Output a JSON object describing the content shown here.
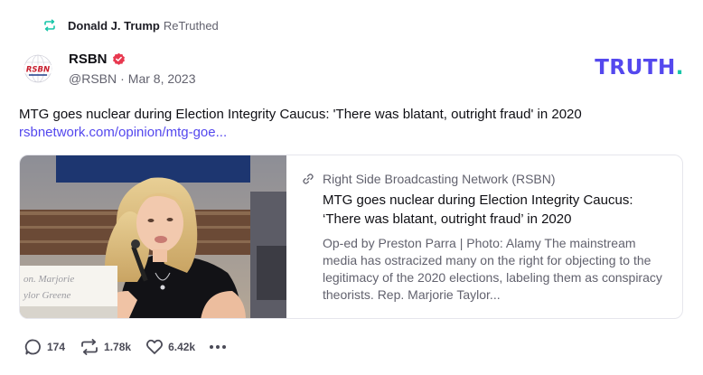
{
  "retruth": {
    "user": "Donald J. Trump",
    "label": "ReTruthed"
  },
  "author": {
    "avatar_text": "RSBN",
    "name": "RSBN",
    "handle": "@RSBN",
    "separator": "·",
    "date": "Mar 8, 2023"
  },
  "brand": {
    "word": "TRUTH",
    "dot": "."
  },
  "post": {
    "text": "MTG goes nuclear during Election Integrity Caucus: 'There was blatant, outright fraud' in 2020",
    "link": "rsbnetwork.com/opinion/mtg-goe..."
  },
  "card": {
    "image_nameplate": "on. Marjorie\nylor Greene",
    "source": "Right Side Broadcasting Network (RSBN)",
    "title": "MTG goes nuclear during Election Integrity Caucus: ‘There was blatant, outright fraud’ in 2020",
    "description": "Op-ed by Preston Parra | Photo: Alamy The mainstream media has ostracized many on the right for objecting to the legitimacy of the 2020 elections, labeling them as conspiracy theorists. Rep. Marjorie Taylor..."
  },
  "actions": {
    "replies": "174",
    "retruths": "1.78k",
    "likes": "6.42k"
  },
  "colors": {
    "brand_purple": "#5448ee",
    "brand_teal": "#17c5a8",
    "retruth_green": "#17c5a8",
    "verified_red": "#e8384f"
  },
  "icons": {
    "retruth": "retruth-arrows-icon",
    "verified": "verified-badge-icon",
    "link": "link-chain-icon",
    "reply": "reply-bubble-icon",
    "retruth_action": "retruth-icon",
    "like": "heart-icon",
    "more": "more-dots-icon"
  }
}
